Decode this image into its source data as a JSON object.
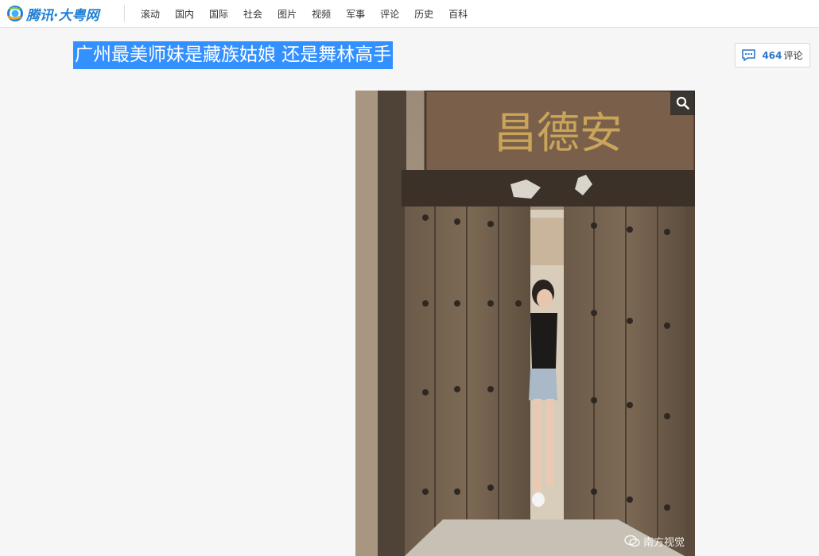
{
  "site": {
    "logo_text": "腾讯·大粤网"
  },
  "nav": {
    "items": [
      "滚动",
      "国内",
      "国际",
      "社会",
      "图片",
      "视频",
      "军事",
      "评论",
      "历史",
      "百科"
    ]
  },
  "article": {
    "title": "广州最美师妹是藏族姑娘 还是舞林高手"
  },
  "comments": {
    "count": "464",
    "label": "评论"
  },
  "photo": {
    "sign_text": "昌德安",
    "watermark": "南方视觉",
    "zoom_icon": "magnifier-icon"
  },
  "colors": {
    "brand_blue": "#1f7fd4",
    "headline_highlight": "#3390ff",
    "comment_count": "#2a77c9"
  }
}
